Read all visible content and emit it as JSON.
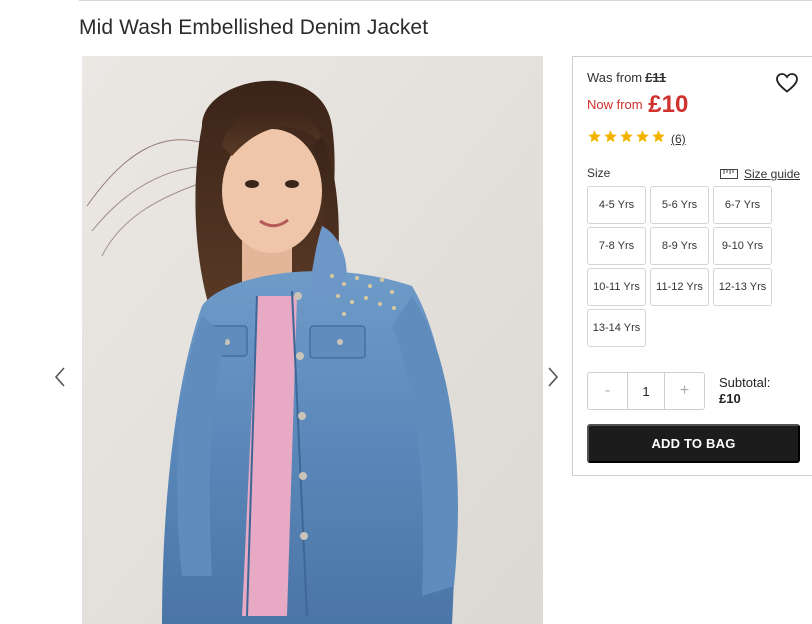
{
  "product": {
    "title": "Mid Wash Embellished Denim Jacket",
    "image_alt": "Girl wearing mid wash embellished denim jacket"
  },
  "pricing": {
    "was_label": "Was from",
    "was_price": "£11",
    "now_label": "Now from",
    "now_price": "£10",
    "accent_color": "#d0312d"
  },
  "rating": {
    "stars": 5,
    "max": 5,
    "review_count": "(6)",
    "star_color": "#f5b301"
  },
  "size": {
    "label": "Size",
    "guide_label": "Size guide",
    "options": [
      "4-5 Yrs",
      "5-6 Yrs",
      "6-7 Yrs",
      "7-8 Yrs",
      "8-9 Yrs",
      "9-10 Yrs",
      "10-11 Yrs",
      "11-12 Yrs",
      "12-13 Yrs",
      "13-14 Yrs"
    ]
  },
  "quantity": {
    "minus": "-",
    "value": "1",
    "plus": "+"
  },
  "subtotal": {
    "label": "Subtotal:",
    "amount": "£10"
  },
  "actions": {
    "add_to_bag": "ADD TO BAG"
  },
  "icons": {
    "prev": "chevron-left-icon",
    "next": "chevron-right-icon",
    "wishlist": "heart-icon",
    "size_guide": "ruler-icon"
  }
}
